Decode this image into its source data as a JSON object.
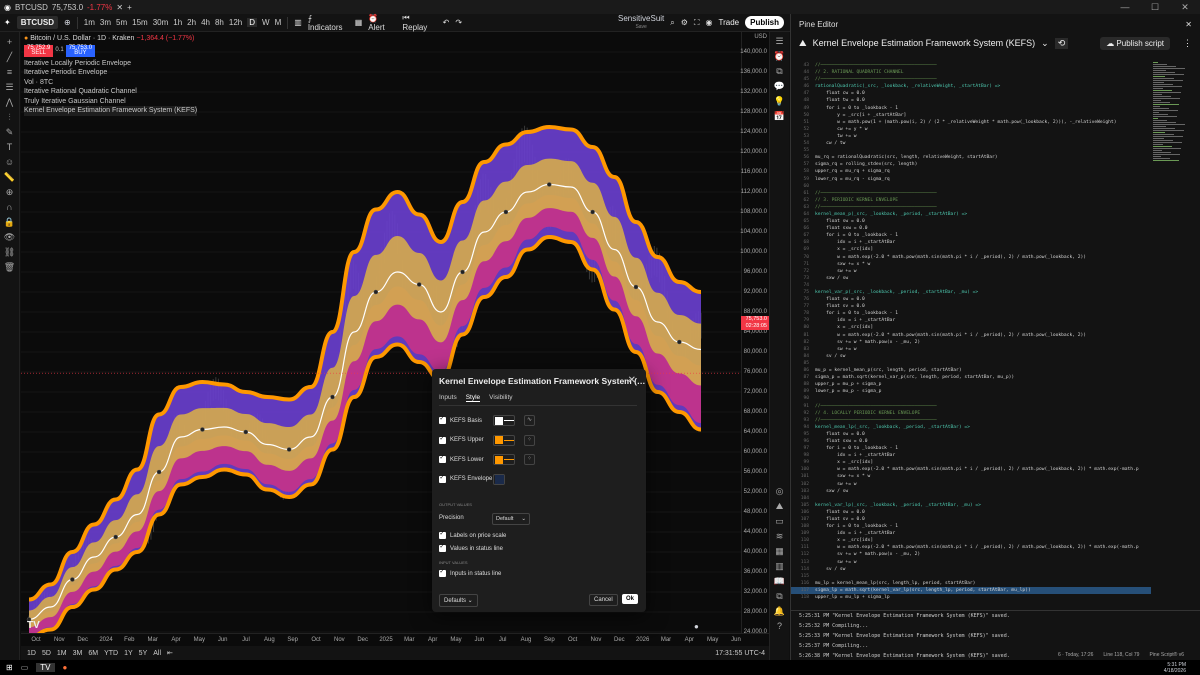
{
  "titlebar": {
    "symbol": "BTCUSD",
    "price": "75,753.0",
    "change": "-1.77%"
  },
  "toolbar": {
    "symbol": "BTCUSD",
    "intervals": [
      "1m",
      "3m",
      "5m",
      "15m",
      "30m",
      "1h",
      "2h",
      "4h",
      "8h",
      "12h",
      "D",
      "W",
      "M"
    ],
    "active_interval": "D",
    "indicators": "Indicators",
    "alert": "Alert",
    "replay": "Replay",
    "layout_name": "SensitiveSuit",
    "layout_sub": "Save",
    "trade": "Trade",
    "publish": "Publish"
  },
  "legend": {
    "title": "Bitcoin / U.S. Dollar · 1D · Kraken",
    "change": "−1,364.4 (−1.77%)",
    "sell_price": "75,752.9",
    "sell_label": "SELL",
    "spread": "0.1",
    "buy_price": "75,753.0",
    "buy_label": "BUY",
    "studies": [
      "Iterative Locally Periodic Envelope",
      "Iterative Periodic Envelope",
      "Vol · 8TC",
      "Iterative Rational Quadratic Channel",
      "Truly Iterative Gaussian Channel",
      "Kernel Envelope Estimation Framework System (KEFS)"
    ]
  },
  "yaxis": {
    "currency": "USD",
    "labels": [
      "140,000.0",
      "136,000.0",
      "132,000.0",
      "128,000.0",
      "124,000.0",
      "120,000.0",
      "116,000.0",
      "112,000.0",
      "108,000.0",
      "104,000.0",
      "100,000.0",
      "96,000.0",
      "92,000.0",
      "88,000.0",
      "84,000.0",
      "80,000.0",
      "76,000.0",
      "72,000.0",
      "68,000.0",
      "64,000.0",
      "60,000.0",
      "56,000.0",
      "52,000.0",
      "48,000.0",
      "44,000.0",
      "40,000.0",
      "36,000.0",
      "32,000.0",
      "28,000.0",
      "24,000.0"
    ],
    "last_price": "75,753.0",
    "countdown": "02:28:05"
  },
  "xaxis": {
    "labels": [
      "Oct",
      "Nov",
      "Dec",
      "2024",
      "Feb",
      "Mar",
      "Apr",
      "May",
      "Jun",
      "Jul",
      "Aug",
      "Sep",
      "Oct",
      "Nov",
      "Dec",
      "2025",
      "Mar",
      "Apr",
      "May",
      "Jun",
      "Jul",
      "Aug",
      "Sep",
      "Oct",
      "Nov",
      "Dec",
      "2026",
      "Mar",
      "Apr",
      "May",
      "Jun"
    ]
  },
  "bottom": {
    "ranges": [
      "1D",
      "5D",
      "1M",
      "3M",
      "6M",
      "YTD",
      "1Y",
      "5Y",
      "All"
    ],
    "time": "17:31:55 UTC-4"
  },
  "chart_data": {
    "type": "line",
    "x": [
      "2023-09",
      "2023-10",
      "2023-11",
      "2023-12",
      "2024-01",
      "2024-02",
      "2024-03",
      "2024-04",
      "2024-05",
      "2024-06",
      "2024-07",
      "2024-08",
      "2024-09",
      "2024-10",
      "2024-11",
      "2024-12",
      "2025-01",
      "2025-02",
      "2025-03",
      "2025-04",
      "2025-05",
      "2025-06",
      "2025-07",
      "2025-08",
      "2025-09",
      "2025-10",
      "2025-11",
      "2025-12",
      "2026-01",
      "2026-02",
      "2026-03",
      "2026-04"
    ],
    "series": [
      {
        "name": "KEFS Basis",
        "values": [
          26500,
          29000,
          34500,
          39000,
          43000,
          47500,
          56000,
          63000,
          64500,
          65000,
          64000,
          61500,
          60500,
          63000,
          71000,
          84000,
          92000,
          96000,
          93500,
          88000,
          96000,
          104000,
          108000,
          112000,
          113500,
          113000,
          108000,
          100500,
          93000,
          86000,
          82000,
          80500
        ]
      },
      {
        "name": "KEFS Upper",
        "values": [
          30500,
          33500,
          40000,
          45500,
          50500,
          56500,
          67500,
          73000,
          74000,
          73500,
          72000,
          71000,
          70500,
          73000,
          84000,
          100000,
          108500,
          112000,
          107500,
          102000,
          110000,
          118000,
          121500,
          124000,
          125000,
          124500,
          121000,
          115000,
          106000,
          99000,
          94000,
          92000
        ]
      },
      {
        "name": "KEFS Lower",
        "values": [
          23000,
          24500,
          29000,
          32500,
          36500,
          40000,
          47500,
          53500,
          55000,
          56500,
          55500,
          52500,
          51000,
          53500,
          60500,
          71000,
          79000,
          81500,
          78000,
          74500,
          83500,
          91000,
          95000,
          100500,
          103000,
          102000,
          96500,
          88500,
          80000,
          72000,
          68000,
          64500
        ]
      }
    ],
    "ylim": [
      24000,
      142000
    ],
    "ylabel": "USD"
  },
  "dialog": {
    "title": "Kernel Envelope Estimation Framework System (…",
    "tabs": [
      "Inputs",
      "Style",
      "Visibility"
    ],
    "active_tab": "Style",
    "plots": [
      {
        "label": "KEFS Basis",
        "color": "#ffffff"
      },
      {
        "label": "KEFS Upper",
        "color": "#ff9800"
      },
      {
        "label": "KEFS Lower",
        "color": "#ff9800"
      },
      {
        "label": "KEFS Envelope",
        "color": "#1a2a4a"
      }
    ],
    "output_values": "OUTPUT VALUES",
    "precision_label": "Precision",
    "precision_value": "Default",
    "labels_on_scale": "Labels on price scale",
    "values_in_status": "Values in status line",
    "input_values": "INPUT VALUES",
    "inputs_in_status": "Inputs in status line",
    "defaults": "Defaults",
    "cancel": "Cancel",
    "ok": "Ok"
  },
  "pine": {
    "header": "Pine Editor",
    "script_name": "Kernel Envelope Estimation Framework System (KEFS)",
    "publish": "Publish script",
    "code": [
      [
        "43",
        "//──────────────────────────────────────────",
        "cm"
      ],
      [
        "44",
        "// 2. RATIONAL QUADRATIC CHANNEL",
        "cm"
      ],
      [
        "45",
        "//──────────────────────────────────────────",
        "cm"
      ],
      [
        "46",
        "rationalQuadratic(_src, _lookback, _relativeWeight, _startAtBar) =>",
        "fn"
      ],
      [
        "47",
        "    float cw = 0.0",
        ""
      ],
      [
        "48",
        "    float tw = 0.0",
        ""
      ],
      [
        "49",
        "    for i = 0 to _lookback - 1",
        ""
      ],
      [
        "50",
        "        y = _src[i + _startAtBar]",
        ""
      ],
      [
        "51",
        "        w = math.pow(1 + (math.pow(i, 2) / (2 * _relativeWeight * math.pow(_lookback, 2))), -_relativeWeight)",
        ""
      ],
      [
        "52",
        "        cw += y * w",
        ""
      ],
      [
        "53",
        "        tw += w",
        ""
      ],
      [
        "54",
        "    cw / tw",
        ""
      ],
      [
        "55",
        "",
        ""
      ],
      [
        "56",
        "mu_rq = rationalQuadratic(src, length, relativeWeight, startAtBar)",
        ""
      ],
      [
        "57",
        "sigma_rq = rolling_stdev(src, length)",
        ""
      ],
      [
        "58",
        "upper_rq = mu_rq + sigma_rq",
        ""
      ],
      [
        "59",
        "lower_rq = mu_rq - sigma_rq",
        ""
      ],
      [
        "60",
        "",
        ""
      ],
      [
        "61",
        "//──────────────────────────────────────────",
        "cm"
      ],
      [
        "62",
        "// 3. PERIODIC KERNEL ENVELOPE",
        "cm"
      ],
      [
        "63",
        "//──────────────────────────────────────────",
        "cm"
      ],
      [
        "64",
        "kernel_mean_p(_src, _lookback, _period, _startAtBar) =>",
        "fn"
      ],
      [
        "65",
        "    float sw = 0.0",
        ""
      ],
      [
        "66",
        "    float sxw = 0.0",
        ""
      ],
      [
        "67",
        "    for i = 0 to _lookback - 1",
        ""
      ],
      [
        "68",
        "        idx = i + _startAtBar",
        ""
      ],
      [
        "69",
        "        x = _src[idx]",
        ""
      ],
      [
        "70",
        "        w = math.exp(-2.0 * math.pow(math.sin(math.pi * i / _period), 2) / math.pow(_lookback, 2))",
        ""
      ],
      [
        "71",
        "        sxw += x * w",
        ""
      ],
      [
        "72",
        "        sw += w",
        ""
      ],
      [
        "73",
        "    sxw / sw",
        ""
      ],
      [
        "74",
        "",
        ""
      ],
      [
        "75",
        "kernel_var_p(_src, _lookback, _period, _startAtBar, _mu) =>",
        "fn"
      ],
      [
        "76",
        "    float sw = 0.0",
        ""
      ],
      [
        "77",
        "    float sv = 0.0",
        ""
      ],
      [
        "78",
        "    for i = 0 to _lookback - 1",
        ""
      ],
      [
        "79",
        "        idx = i + _startAtBar",
        ""
      ],
      [
        "80",
        "        x = _src[idx]",
        ""
      ],
      [
        "81",
        "        w = math.exp(-2.0 * math.pow(math.sin(math.pi * i / _period), 2) / math.pow(_lookback, 2))",
        ""
      ],
      [
        "82",
        "        sv += w * math.pow(x - _mu, 2)",
        ""
      ],
      [
        "83",
        "        sw += w",
        ""
      ],
      [
        "84",
        "    sv / sw",
        ""
      ],
      [
        "85",
        "",
        ""
      ],
      [
        "86",
        "mu_p = kernel_mean_p(src, length, period, startAtBar)",
        ""
      ],
      [
        "87",
        "sigma_p = math.sqrt(kernel_var_p(src, length, period, startAtBar, mu_p))",
        ""
      ],
      [
        "88",
        "upper_p = mu_p + sigma_p",
        ""
      ],
      [
        "89",
        "lower_p = mu_p - sigma_p",
        ""
      ],
      [
        "90",
        "",
        ""
      ],
      [
        "91",
        "//──────────────────────────────────────────",
        "cm"
      ],
      [
        "92",
        "// 4. LOCALLY PERIODIC KERNEL ENVELOPE",
        "cm"
      ],
      [
        "93",
        "//──────────────────────────────────────────",
        "cm"
      ],
      [
        "94",
        "kernel_mean_lp(_src, _lookback, _period, _startAtBar) =>",
        "fn"
      ],
      [
        "95",
        "    float sw = 0.0",
        ""
      ],
      [
        "96",
        "    float sxw = 0.0",
        ""
      ],
      [
        "97",
        "    for i = 0 to _lookback - 1",
        ""
      ],
      [
        "98",
        "        idx = i + _startAtBar",
        ""
      ],
      [
        "99",
        "        x = _src[idx]",
        ""
      ],
      [
        "100",
        "        w = math.exp(-2.0 * math.pow(math.sin(math.pi * i / _period), 2) / math.pow(_lookback, 2)) * math.exp(-math.p",
        ""
      ],
      [
        "101",
        "        sxw += x * w",
        ""
      ],
      [
        "102",
        "        sw += w",
        ""
      ],
      [
        "103",
        "    sxw / sw",
        ""
      ],
      [
        "104",
        "",
        ""
      ],
      [
        "105",
        "kernel_var_lp(_src, _lookback, _period, _startAtBar, _mu) =>",
        "fn"
      ],
      [
        "106",
        "    float sw = 0.0",
        ""
      ],
      [
        "107",
        "    float sv = 0.0",
        ""
      ],
      [
        "108",
        "    for i = 0 to _lookback - 1",
        ""
      ],
      [
        "109",
        "        idx = i + _startAtBar",
        ""
      ],
      [
        "110",
        "        x = _src[idx]",
        ""
      ],
      [
        "111",
        "        w = math.exp(-2.0 * math.pow(math.sin(math.pi * i / _period), 2) / math.pow(_lookback, 2)) * math.exp(-math.p",
        ""
      ],
      [
        "112",
        "        sv += w * math.pow(x - _mu, 2)",
        ""
      ],
      [
        "113",
        "        sw += w",
        ""
      ],
      [
        "114",
        "    sv / sw",
        ""
      ],
      [
        "115",
        "",
        ""
      ],
      [
        "116",
        "mu_lp = kernel_mean_lp(src, length_lp, period, startAtBar)",
        ""
      ],
      [
        "117",
        "sigma_lp = math.sqrt(kernel_var_lp(src, length_lp, period, startAtBar, mu_lp))",
        "hl"
      ],
      [
        "118",
        "upper_lp = mu_lp + sigma_lp",
        ""
      ]
    ],
    "console": [
      "5:25:31 PM \"Kernel Envelope Estimation Framework System (KEFS)\" saved.",
      "5:25:32 PM Compiling...",
      "5:25:33 PM \"Kernel Envelope Estimation Framework System (KEFS)\" saved.",
      "5:25:37 PM Compiling...",
      "5:26:38 PM \"Kernel Envelope Estimation Framework System (KEFS)\" saved."
    ],
    "status": [
      "6 · Today, 17:26",
      "Line 118, Col 79",
      "Pine Script® v6"
    ]
  },
  "taskbar": {
    "time": "5:31 PM",
    "date": "4/18/2026"
  }
}
